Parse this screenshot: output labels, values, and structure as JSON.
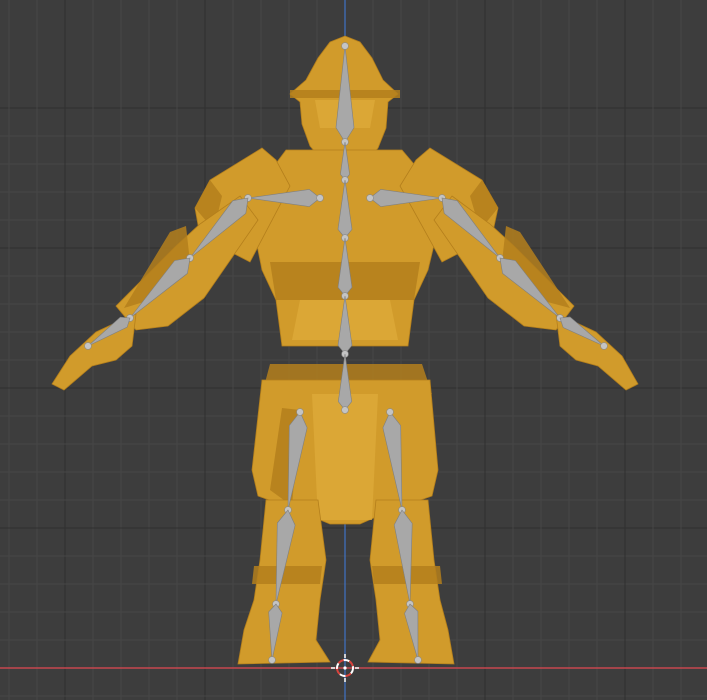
{
  "viewport": {
    "view": "front-orthographic",
    "background_color": "#3d3d3d",
    "grid_minor_color": "#464646",
    "grid_major_color": "#303030",
    "x_axis_color": "#c7464f",
    "z_axis_color": "#3f73c6"
  },
  "model": {
    "type": "armored-warrior-mesh",
    "material_color": "#d19b2b",
    "shade_color": "#b47f1c",
    "highlight_color": "#e0ad3c"
  },
  "armature": {
    "bone_color": "#a8a8a8",
    "joint_color": "#c4c4c4",
    "bones": [
      "head",
      "neck",
      "spine-upper",
      "spine-mid",
      "spine-lower",
      "hips",
      "shoulder-left",
      "upper-arm-left",
      "forearm-left",
      "hand-left",
      "shoulder-right",
      "upper-arm-right",
      "forearm-right",
      "hand-right",
      "thigh-left",
      "shin-left",
      "foot-left",
      "thigh-right",
      "shin-right",
      "foot-right"
    ]
  },
  "cursor_3d": {
    "icon": "3d-cursor-icon",
    "color_a": "#ffffff",
    "color_b": "#d9423c"
  }
}
